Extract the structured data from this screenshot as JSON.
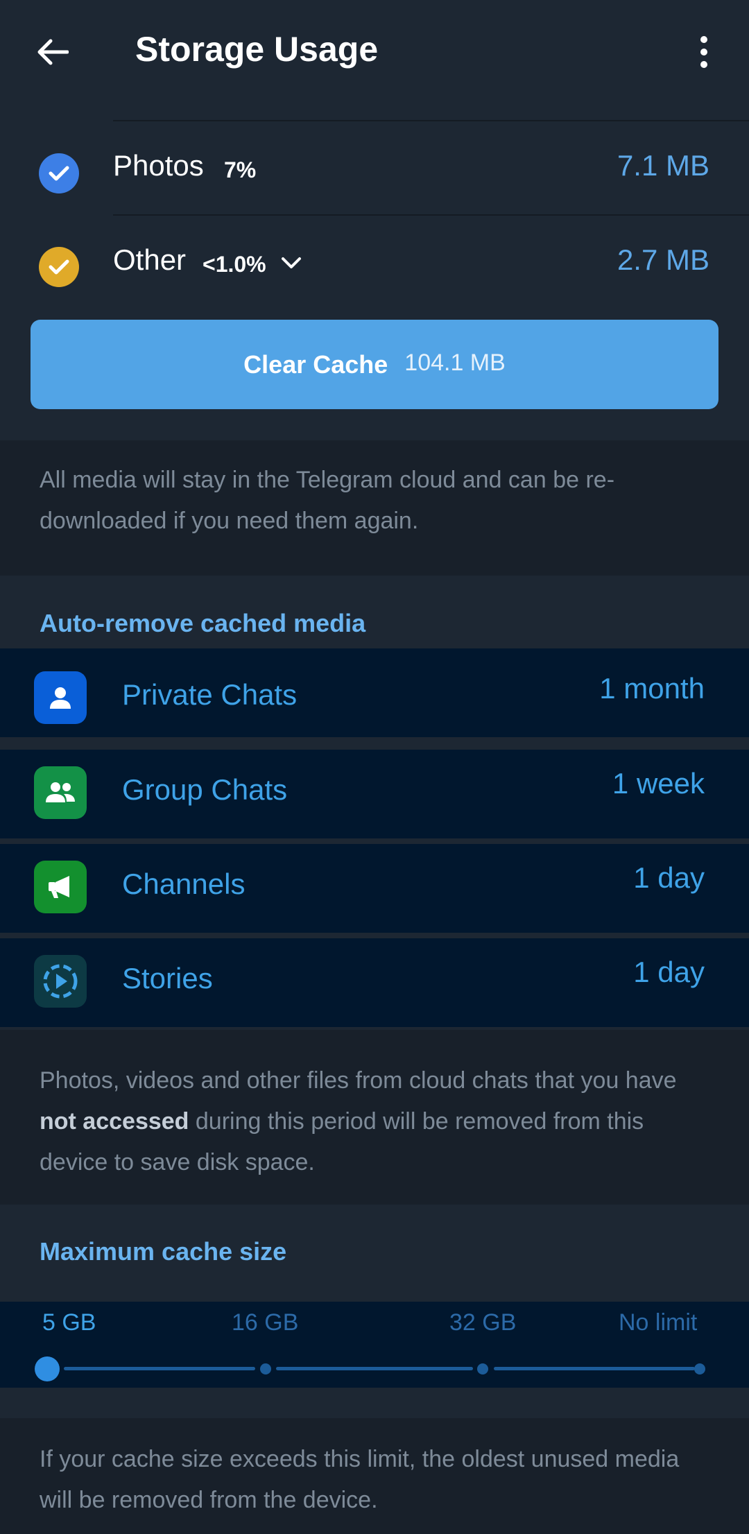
{
  "header": {
    "title": "Storage Usage",
    "back_icon": "arrow-left-icon",
    "menu_icon": "more-vertical-icon"
  },
  "categories": [
    {
      "name": "Photos",
      "percent": "7%",
      "size": "7.1 MB",
      "check_color": "#3d7fe6",
      "checked": true
    },
    {
      "name": "Other",
      "percent": "<1.0%",
      "size": "2.7 MB",
      "check_color": "#e0aa29",
      "checked": true,
      "expandable": true
    }
  ],
  "clear_cache": {
    "label": "Clear Cache",
    "size": "104.1 MB"
  },
  "cloud_note": "All media will stay in the Telegram cloud and can be re-downloaded if you need them again.",
  "auto_remove": {
    "header": "Auto-remove cached media",
    "items": [
      {
        "label": "Private Chats",
        "value": "1 month",
        "icon": "person-icon",
        "icon_color": "#0a5fd8"
      },
      {
        "label": "Group Chats",
        "value": "1 week",
        "icon": "group-icon",
        "icon_color": "#139147"
      },
      {
        "label": "Channels",
        "value": "1 day",
        "icon": "megaphone-icon",
        "icon_color": "#13902e"
      },
      {
        "label": "Stories",
        "value": "1 day",
        "icon": "stories-icon",
        "icon_color": "#0d3a44"
      }
    ],
    "note_part1": "Photos, videos and other files from cloud chats that you have ",
    "note_bold": "not accessed",
    "note_part2": " during this period will be removed from this device to save disk space."
  },
  "max_cache": {
    "header": "Maximum cache size",
    "options": [
      "5 GB",
      "16 GB",
      "32 GB",
      "No limit"
    ],
    "selected": "5 GB",
    "note": "If your cache size exceeds this limit, the oldest unused media will be removed from the device."
  }
}
